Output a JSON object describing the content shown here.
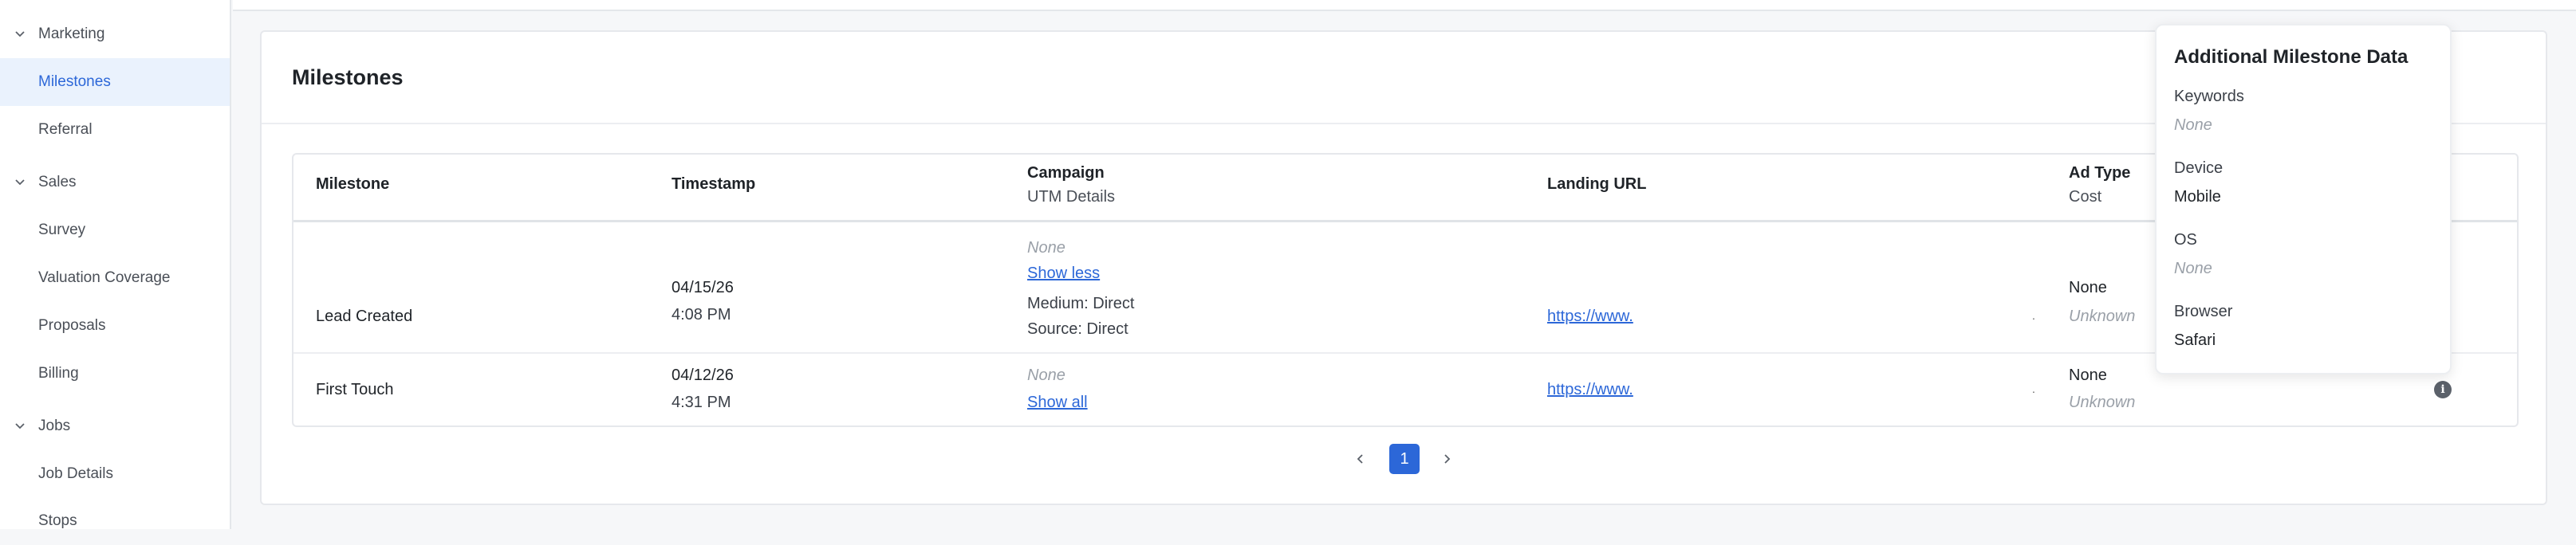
{
  "sidebar": {
    "sections": [
      {
        "label": "Marketing",
        "items": [
          "Milestones",
          "Referral"
        ]
      },
      {
        "label": "Sales",
        "items": [
          "Survey",
          "Valuation Coverage",
          "Proposals",
          "Billing"
        ]
      },
      {
        "label": "Jobs",
        "items": [
          "Job Details",
          "Stops"
        ]
      }
    ],
    "active_item": "Milestones"
  },
  "card": {
    "title": "Milestones"
  },
  "table": {
    "headers": {
      "milestone": "Milestone",
      "timestamp": "Timestamp",
      "campaign": "Campaign",
      "campaign_sub": "UTM Details",
      "landing_url": "Landing URL",
      "ad_type": "Ad Type",
      "ad_type_sub": "Cost"
    },
    "rows": [
      {
        "milestone": "Lead Created",
        "date": "04/15/26",
        "time": "4:08 PM",
        "campaign": "None",
        "toggle": "Show less",
        "utm_medium": "Medium: Direct",
        "utm_source": "Source: Direct",
        "landing_url": "https://www.",
        "dot": ".",
        "ad_type": "None",
        "cost": "Unknown"
      },
      {
        "milestone": "First Touch",
        "date": "04/12/26",
        "time": "4:31 PM",
        "campaign": "None",
        "toggle": "Show all",
        "landing_url": "https://www.",
        "dot": ".",
        "ad_type": "None",
        "cost": "Unknown",
        "info_icon": "info-icon"
      }
    ]
  },
  "pagination": {
    "current": "1",
    "prev_icon": "chevron-left-icon",
    "next_icon": "chevron-right-icon"
  },
  "popover": {
    "title": "Additional Milestone Data",
    "fields": [
      {
        "label": "Keywords",
        "value": "None",
        "empty": true
      },
      {
        "label": "Device",
        "value": "Mobile",
        "empty": false
      },
      {
        "label": "OS",
        "value": "None",
        "empty": true
      },
      {
        "label": "Browser",
        "value": "Safari",
        "empty": false
      }
    ]
  },
  "colors": {
    "accent": "#2c67d8",
    "active_bg": "#eaf2fd",
    "muted_text": "#9aa0a8"
  }
}
